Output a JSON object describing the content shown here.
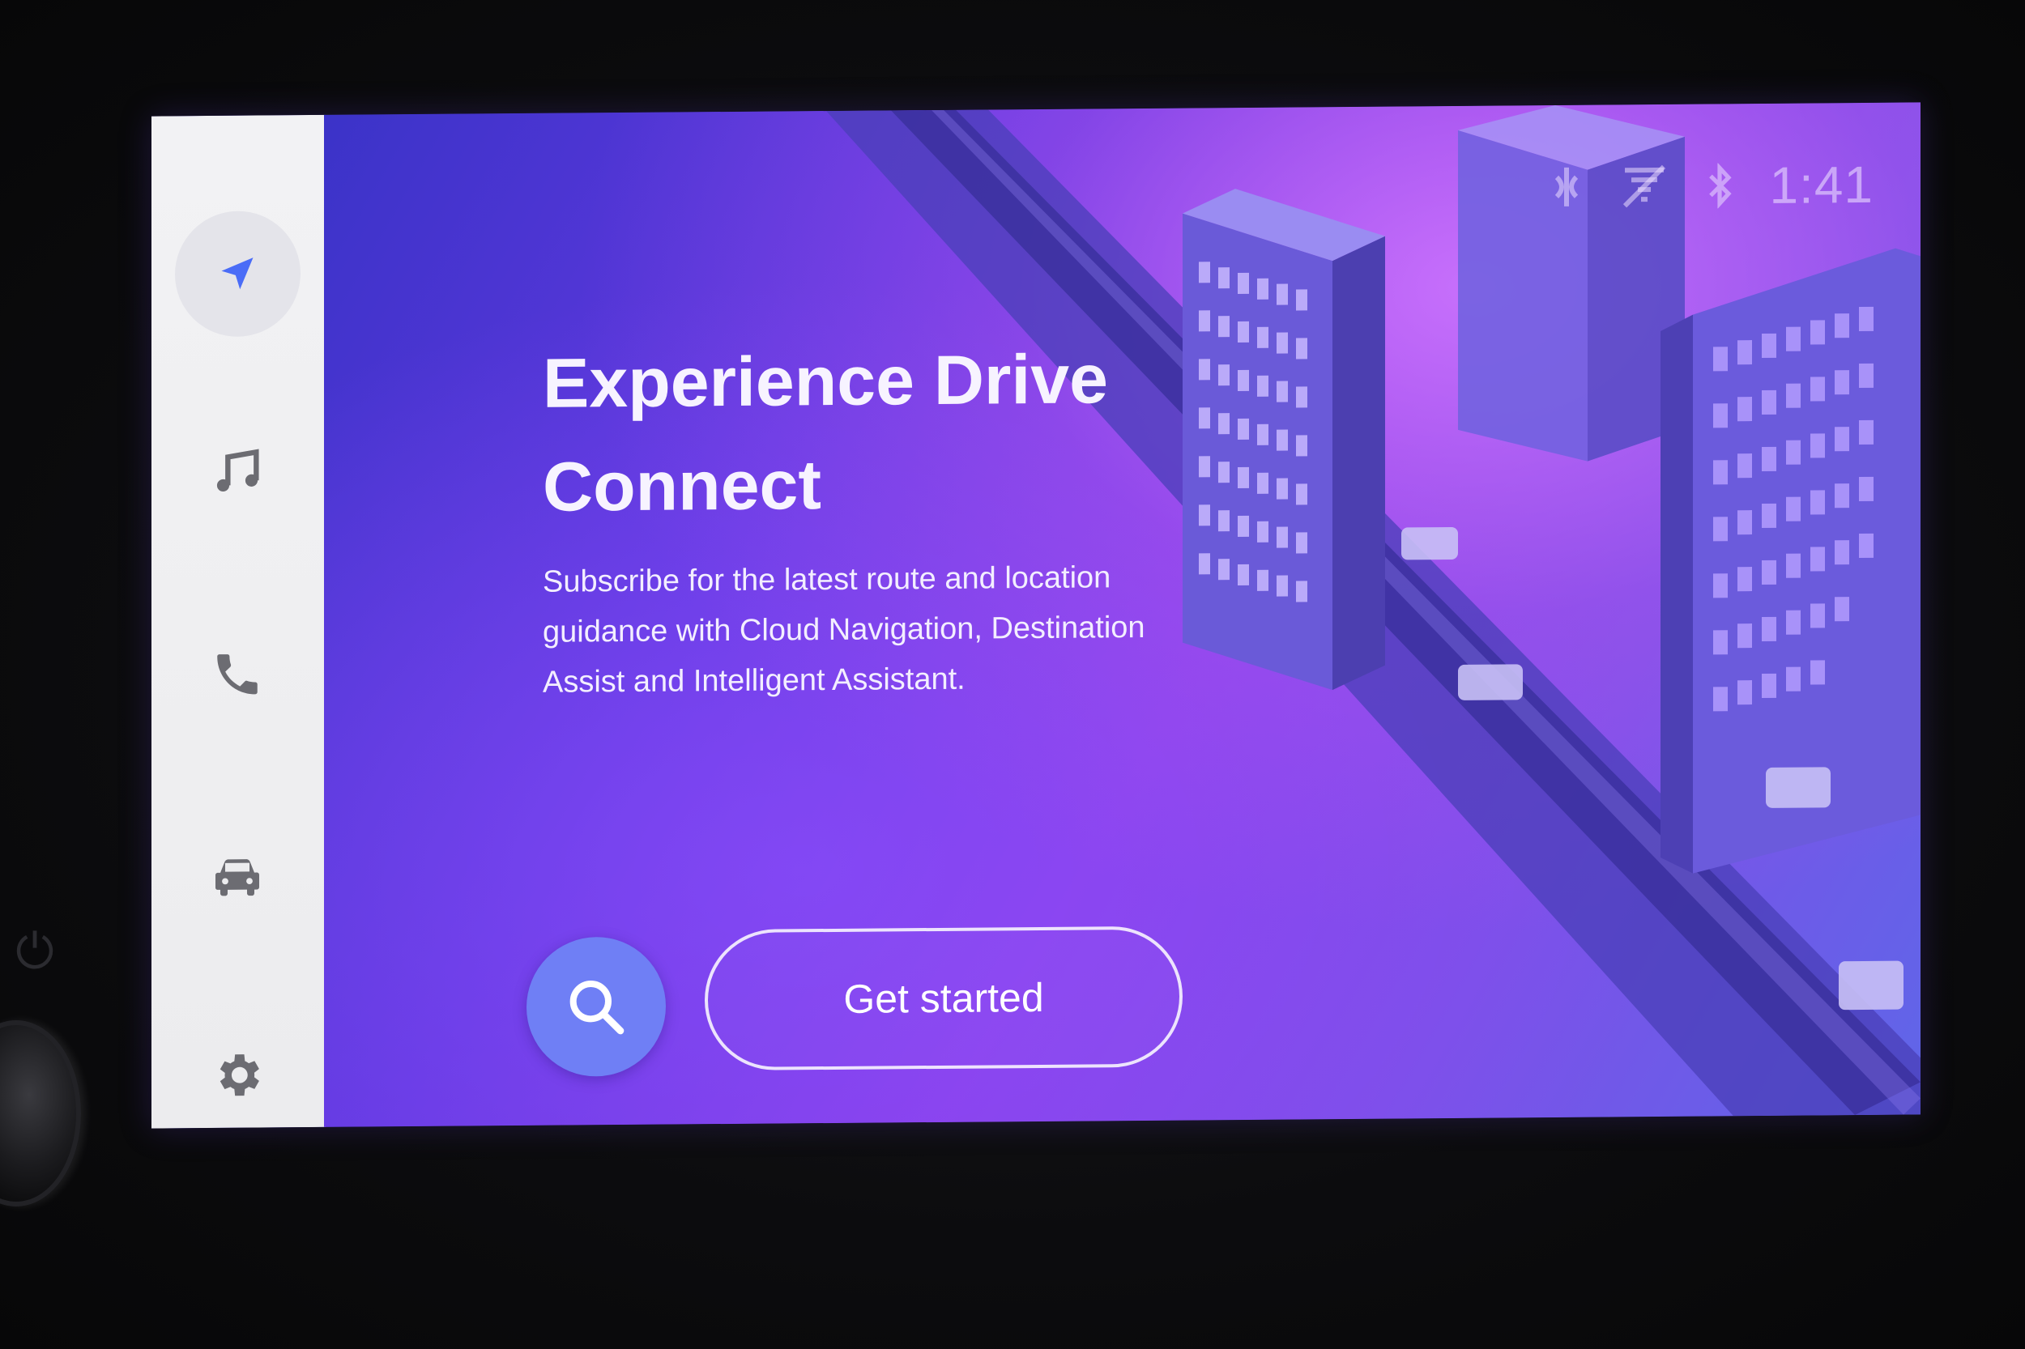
{
  "status_bar": {
    "time": "1:41",
    "icons": [
      "wireless-charging-icon",
      "data-disabled-icon",
      "bluetooth-icon"
    ]
  },
  "sidebar": {
    "items": [
      {
        "name": "navigation",
        "icon": "navigation-arrow-icon",
        "active": true
      },
      {
        "name": "music",
        "icon": "music-note-icon",
        "active": false
      },
      {
        "name": "phone",
        "icon": "phone-icon",
        "active": false
      },
      {
        "name": "vehicle",
        "icon": "car-icon",
        "active": false
      },
      {
        "name": "settings",
        "icon": "gear-icon",
        "active": false
      }
    ]
  },
  "main": {
    "title_line1": "Experience Drive",
    "title_line2": "Connect",
    "description_line1": "Subscribe for the latest route and location",
    "description_line2": "guidance with Cloud Navigation, Destination",
    "description_line3": "Assist and Intelligent Assistant.",
    "search_icon": "search-icon",
    "cta_label": "Get started"
  },
  "colors": {
    "accent": "#4a6cf7",
    "search_button": "#6f7ff5",
    "sidebar_bg": "#f2f2f4",
    "background_gradient": [
      "#3b33c8",
      "#8a3fe8",
      "#5f66e8"
    ]
  }
}
